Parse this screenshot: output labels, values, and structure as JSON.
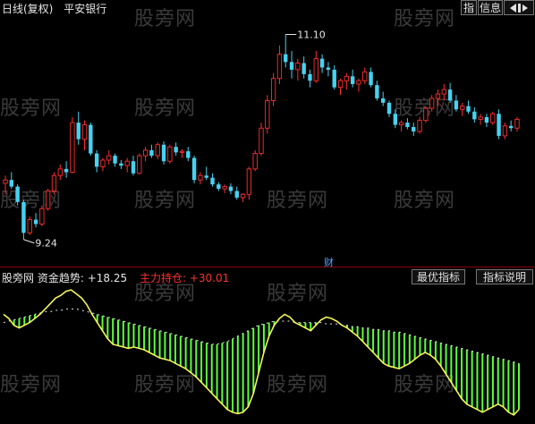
{
  "header": {
    "period": "日线(复权)",
    "stock_name": "平安银行",
    "buttons": [
      "指",
      "信息"
    ],
    "nav_icon": "arrow-left-icon"
  },
  "price": {
    "high_label": "11.10",
    "low_label": "9.24",
    "event_marker": "财"
  },
  "indicator": {
    "source": "股旁网",
    "line1_name": "资金趋势",
    "line1_value": "+18.25",
    "line2_name": "主力持仓",
    "line2_value": "+30.01",
    "buttons": [
      "最优指标",
      "指标说明"
    ]
  },
  "watermark": "股旁网",
  "colors": {
    "up": "#ff3030",
    "down": "#46d2f0",
    "trend_line": "#f5f55a",
    "bars": "#5aff3c",
    "dotted": "#e6e6e6",
    "divider": "#8a0000"
  },
  "chart_data": {
    "type": "candlestick+indicator",
    "candles": [
      [
        9.75,
        9.82,
        9.65,
        9.78
      ],
      [
        9.78,
        9.85,
        9.7,
        9.72
      ],
      [
        9.72,
        9.74,
        9.55,
        9.58
      ],
      [
        9.58,
        9.6,
        9.24,
        9.3
      ],
      [
        9.3,
        9.45,
        9.28,
        9.42
      ],
      [
        9.42,
        9.48,
        9.35,
        9.38
      ],
      [
        9.38,
        9.55,
        9.36,
        9.52
      ],
      [
        9.52,
        9.7,
        9.5,
        9.68
      ],
      [
        9.68,
        9.85,
        9.65,
        9.82
      ],
      [
        9.82,
        9.92,
        9.78,
        9.88
      ],
      [
        9.88,
        9.95,
        9.8,
        9.85
      ],
      [
        9.85,
        10.35,
        9.84,
        10.3
      ],
      [
        10.3,
        10.4,
        10.1,
        10.15
      ],
      [
        10.15,
        10.32,
        10.05,
        10.28
      ],
      [
        10.28,
        10.3,
        10.0,
        10.02
      ],
      [
        10.02,
        10.05,
        9.85,
        9.9
      ],
      [
        9.9,
        9.98,
        9.86,
        9.96
      ],
      [
        9.96,
        10.05,
        9.92,
        10.0
      ],
      [
        10.0,
        10.02,
        9.9,
        9.93
      ],
      [
        9.93,
        9.96,
        9.88,
        9.91
      ],
      [
        9.91,
        9.98,
        9.85,
        9.95
      ],
      [
        9.95,
        10.0,
        9.82,
        9.84
      ],
      [
        9.84,
        10.02,
        9.83,
        10.0
      ],
      [
        10.0,
        10.08,
        9.95,
        10.05
      ],
      [
        10.05,
        10.1,
        9.98,
        10.0
      ],
      [
        10.0,
        10.12,
        9.97,
        10.1
      ],
      [
        10.1,
        10.13,
        9.92,
        9.95
      ],
      [
        9.95,
        10.1,
        9.93,
        10.08
      ],
      [
        10.08,
        10.12,
        10.0,
        10.03
      ],
      [
        10.03,
        10.06,
        9.98,
        10.04
      ],
      [
        10.04,
        10.08,
        9.95,
        9.98
      ],
      [
        9.98,
        10.0,
        9.75,
        9.78
      ],
      [
        9.78,
        9.85,
        9.74,
        9.82
      ],
      [
        9.82,
        9.9,
        9.78,
        9.8
      ],
      [
        9.8,
        9.84,
        9.72,
        9.74
      ],
      [
        9.74,
        9.76,
        9.68,
        9.7
      ],
      [
        9.7,
        9.74,
        9.66,
        9.72
      ],
      [
        9.72,
        9.75,
        9.65,
        9.68
      ],
      [
        9.68,
        9.72,
        9.6,
        9.62
      ],
      [
        9.62,
        9.66,
        9.58,
        9.65
      ],
      [
        9.65,
        9.9,
        9.6,
        9.88
      ],
      [
        9.88,
        10.05,
        9.86,
        10.02
      ],
      [
        10.02,
        10.3,
        10.0,
        10.25
      ],
      [
        10.25,
        10.55,
        10.2,
        10.5
      ],
      [
        10.5,
        10.75,
        10.45,
        10.7
      ],
      [
        10.7,
        11.0,
        10.65,
        10.92
      ],
      [
        10.92,
        11.1,
        10.8,
        10.85
      ],
      [
        10.85,
        10.95,
        10.7,
        10.78
      ],
      [
        10.78,
        10.88,
        10.68,
        10.84
      ],
      [
        10.84,
        10.9,
        10.7,
        10.74
      ],
      [
        10.74,
        10.78,
        10.62,
        10.68
      ],
      [
        10.68,
        10.95,
        10.66,
        10.88
      ],
      [
        10.88,
        10.92,
        10.75,
        10.8
      ],
      [
        10.8,
        10.85,
        10.72,
        10.78
      ],
      [
        10.78,
        10.82,
        10.6,
        10.62
      ],
      [
        10.62,
        10.7,
        10.55,
        10.68
      ],
      [
        10.68,
        10.75,
        10.6,
        10.72
      ],
      [
        10.72,
        10.78,
        10.62,
        10.65
      ],
      [
        10.65,
        10.7,
        10.58,
        10.68
      ],
      [
        10.68,
        10.8,
        10.65,
        10.76
      ],
      [
        10.76,
        10.8,
        10.62,
        10.64
      ],
      [
        10.64,
        10.68,
        10.5,
        10.52
      ],
      [
        10.52,
        10.58,
        10.45,
        10.48
      ],
      [
        10.48,
        10.5,
        10.35,
        10.38
      ],
      [
        10.38,
        10.42,
        10.25,
        10.28
      ],
      [
        10.28,
        10.32,
        10.22,
        10.3
      ],
      [
        10.3,
        10.34,
        10.24,
        10.26
      ],
      [
        10.26,
        10.3,
        10.18,
        10.22
      ],
      [
        10.22,
        10.35,
        10.2,
        10.32
      ],
      [
        10.32,
        10.45,
        10.3,
        10.43
      ],
      [
        10.43,
        10.55,
        10.4,
        10.52
      ],
      [
        10.52,
        10.6,
        10.45,
        10.56
      ],
      [
        10.56,
        10.65,
        10.5,
        10.6
      ],
      [
        10.6,
        10.66,
        10.48,
        10.5
      ],
      [
        10.5,
        10.55,
        10.4,
        10.42
      ],
      [
        10.42,
        10.48,
        10.36,
        10.45
      ],
      [
        10.45,
        10.5,
        10.38,
        10.4
      ],
      [
        10.4,
        10.44,
        10.3,
        10.33
      ],
      [
        10.33,
        10.38,
        10.28,
        10.35
      ],
      [
        10.35,
        10.38,
        10.26,
        10.3
      ],
      [
        10.3,
        10.4,
        10.28,
        10.38
      ],
      [
        10.38,
        10.42,
        10.15,
        10.18
      ],
      [
        10.18,
        10.3,
        10.15,
        10.27
      ],
      [
        10.27,
        10.32,
        10.22,
        10.25
      ],
      [
        10.25,
        10.35,
        10.22,
        10.33
      ]
    ],
    "price_range": [
      9.1,
      11.25
    ],
    "trend_line": [
      58,
      55,
      50,
      48,
      50,
      52,
      55,
      58,
      62,
      66,
      70,
      72,
      75,
      76,
      73,
      70,
      65,
      58,
      52,
      46,
      40,
      36,
      35,
      34,
      33,
      34,
      33,
      32,
      30,
      28,
      26,
      25,
      24,
      22,
      20,
      18,
      15,
      12,
      8,
      4,
      0,
      -4,
      -8,
      -12,
      -14,
      -15,
      -14,
      -10,
      0,
      15,
      30,
      42,
      50,
      55,
      58,
      56,
      52,
      50,
      48,
      46,
      50,
      54,
      56,
      55,
      53,
      50,
      48,
      45,
      42,
      38,
      34,
      30,
      26,
      22,
      20,
      19,
      18,
      20,
      22,
      25,
      28,
      30,
      28,
      25,
      20,
      14,
      8,
      2,
      -4,
      -8,
      -10,
      -12,
      -14,
      -12,
      -10,
      -8,
      -10,
      -14,
      -16,
      -12
    ],
    "bar_line": [
      52,
      53,
      54,
      55,
      56,
      57,
      58,
      59,
      60,
      60,
      61,
      61,
      62,
      62,
      62,
      61,
      60,
      59,
      58,
      57,
      56,
      55,
      54,
      53,
      52,
      51,
      50,
      49,
      48,
      47,
      46,
      45,
      44,
      43,
      42,
      41,
      40,
      39,
      38,
      37,
      36,
      36,
      37,
      38,
      40,
      42,
      44,
      46,
      48,
      50,
      51,
      52,
      53,
      53,
      53,
      53,
      52,
      52,
      52,
      52,
      52,
      52,
      51,
      51,
      51,
      50,
      50,
      49,
      49,
      48,
      48,
      47,
      47,
      46,
      46,
      45,
      45,
      44,
      43,
      42,
      41,
      40,
      39,
      38,
      37,
      36,
      35,
      34,
      33,
      32,
      31,
      30,
      29,
      28,
      27,
      26,
      25,
      24,
      23,
      22
    ],
    "indicator_range": [
      -20,
      80
    ]
  }
}
